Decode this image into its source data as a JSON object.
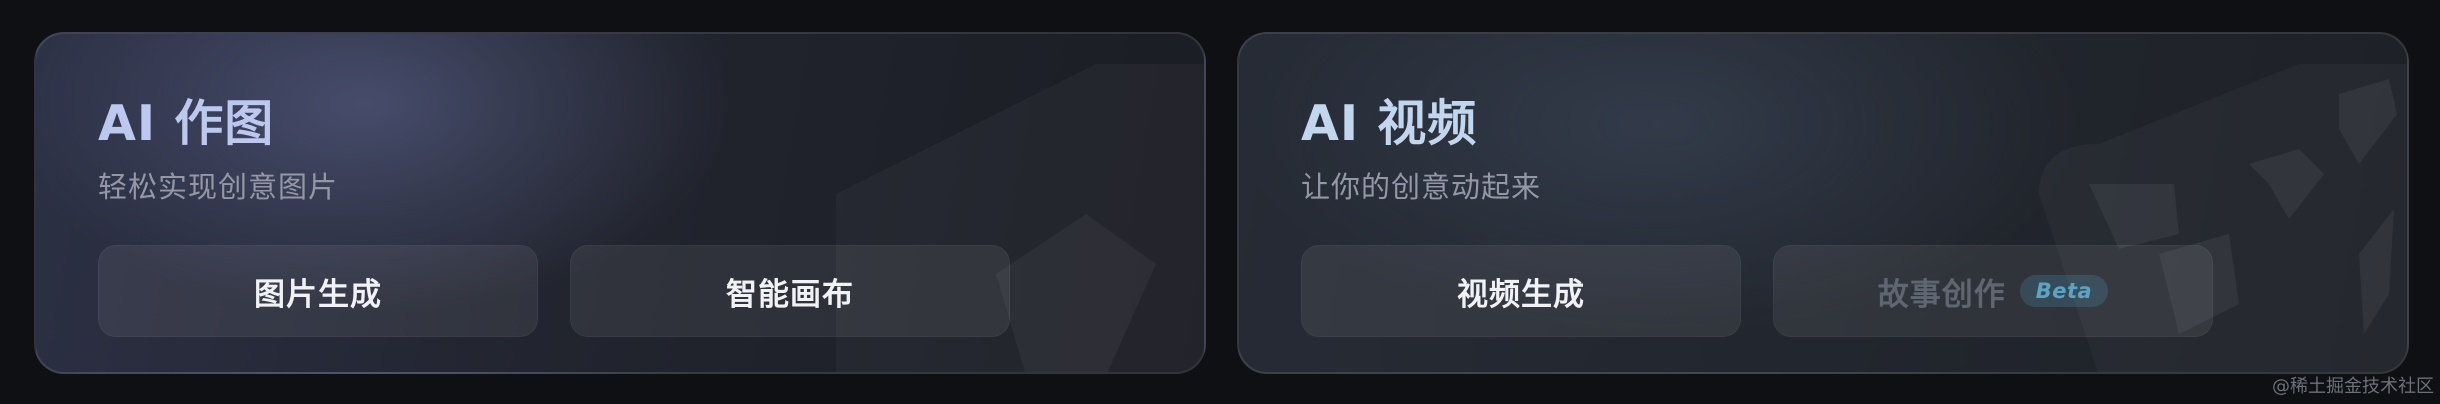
{
  "cards": [
    {
      "title": "AI 作图",
      "subtitle": "轻松实现创意图片",
      "buttons": [
        {
          "label": "图片生成"
        },
        {
          "label": "智能画布"
        }
      ]
    },
    {
      "title": "AI 视频",
      "subtitle": "让你的创意动起来",
      "buttons": [
        {
          "label": "视频生成"
        },
        {
          "label": "故事创作",
          "badge": "Beta",
          "disabled": true
        }
      ]
    }
  ],
  "watermark": "@稀土掘金技术社区",
  "colors": {
    "background": "#0e1014",
    "image_title": "#bcc8ee",
    "video_title": "#c2d6ee",
    "subtitle": "#9498a6",
    "button_text": "#f1f2f5",
    "disabled_text": "#5f6571",
    "beta_badge": "#5ea4c2"
  }
}
